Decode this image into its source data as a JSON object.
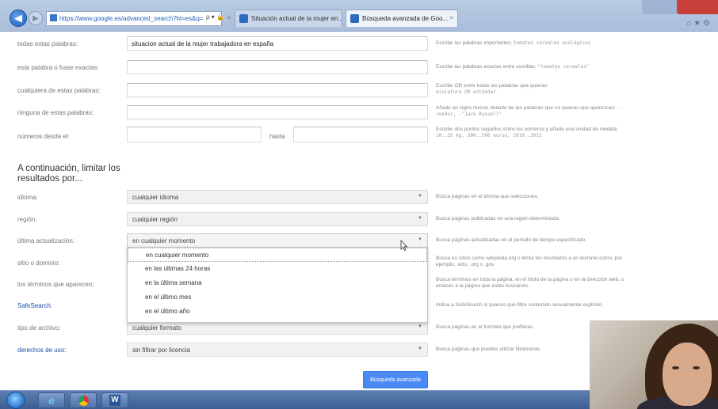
{
  "browser": {
    "address": "https://www.google.es/advanced_search?hl=es&q=",
    "address_tools": "ρ ▾ 🔒 ☼",
    "tabs": [
      {
        "label": "Situación actual de la mujer en..."
      },
      {
        "label": "Búsqueda avanzada de Goo...",
        "close": "×"
      }
    ],
    "right_chrome": "⌂ ★ ⚙"
  },
  "form": {
    "rows": [
      {
        "label": "todas estas palabras:",
        "value": "situacion actual de la mujer trabajadora en españa",
        "hint": "Escribe las palabras importantes:",
        "hint_example": "tomates cereales ecológicos"
      },
      {
        "label": "esta palabra o frase exactas:",
        "value": "",
        "hint": "Escribe las palabras exactas entre comillas:",
        "hint_example": "\"tomates cereales\""
      },
      {
        "label": "cualquiera de estas palabras:",
        "value": "",
        "hint": "Escribe OR entre todas las palabras que quieras:",
        "hint_example": "miniatura OR estándar"
      },
      {
        "label": "ninguna de estas palabras:",
        "value": "",
        "hint": "Añade un signo menos delante de las palabras que no quieras que aparezcan:",
        "hint_example": "-roedor, -\"Jack Russell\""
      },
      {
        "label": "números desde el:",
        "value": "",
        "to_label": "hasta",
        "to_value": "",
        "hint": "Escribe dos puntos seguidos entre los números y añade una unidad de medida:",
        "hint_example": "10..35 kg, 300..500 euros, 2010..2011"
      }
    ],
    "section_title": "A continuación, limitar los resultados por...",
    "filters": [
      {
        "label": "idioma:",
        "value": "cualquier idioma",
        "hint": "Busca páginas en el idioma que selecciones.",
        "link": false
      },
      {
        "label": "región:",
        "value": "cualquier región",
        "hint": "Busca páginas publicadas en una región determinada.",
        "link": false
      },
      {
        "label": "última actualización:",
        "value": "en cualquier momento",
        "hint": "Busca páginas actualizadas en el periodo de tiempo especificado.",
        "link": false
      },
      {
        "label": "sitio o dominio:",
        "value": "",
        "hint": "Busca en sitios como wikipedia.org o limita los resultados a un dominio como, por ejemplo, .edu, .org o .gov",
        "link": false
      },
      {
        "label": "los términos que aparecen:",
        "value": "",
        "hint": "Busca términos en toda la página, en el título de la página o en la dirección web, o enlaces a la página que estás buscando.",
        "link": false
      },
      {
        "label": "SafeSearch:",
        "value": "",
        "hint": "Indica a SafeSearch si quieres que filtre contenido sexualmente explícito.",
        "link": true
      },
      {
        "label": "tipo de archivo:",
        "value": "cualquier formato",
        "hint": "Busca páginas en el formato que prefieras.",
        "link": false
      },
      {
        "label": "derechos de uso:",
        "value": "sin filtrar por licencia",
        "hint": "Busca páginas que puedes utilizar libremente.",
        "link": true
      }
    ],
    "dropdown_options": [
      "en cualquier momento",
      "en las últimas 24 horas",
      "en la última semana",
      "en el último mes",
      "en el último año"
    ],
    "submit_label": "Búsqueda avanzada"
  },
  "taskbar": {
    "word_icon": "W"
  },
  "colors": {
    "link": "#1a4fa8",
    "button": "#4a8af4",
    "close_button": "#c8403a"
  }
}
